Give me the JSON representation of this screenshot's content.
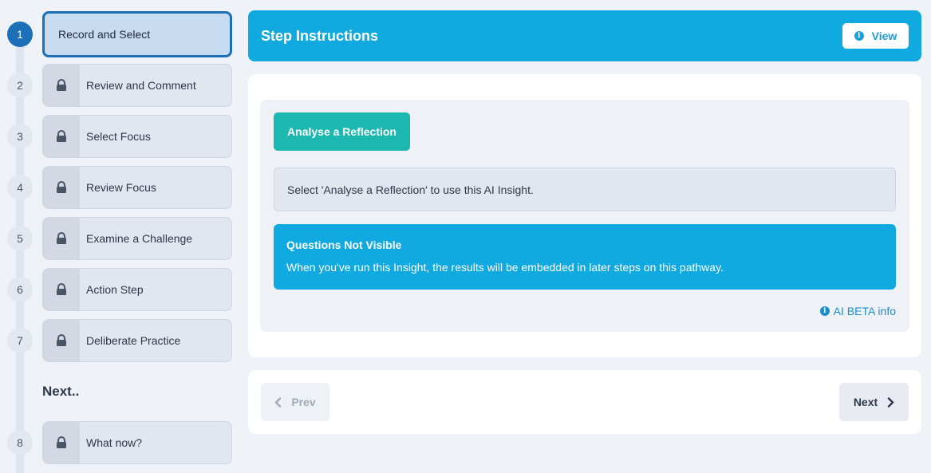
{
  "steps": [
    {
      "number": "1",
      "label": "Record and Select",
      "state": "active"
    },
    {
      "number": "2",
      "label": "Review and Comment",
      "state": "locked"
    },
    {
      "number": "3",
      "label": "Select Focus",
      "state": "locked"
    },
    {
      "number": "4",
      "label": "Review Focus",
      "state": "locked"
    },
    {
      "number": "5",
      "label": "Examine a Challenge",
      "state": "locked"
    },
    {
      "number": "6",
      "label": "Action Step",
      "state": "locked"
    },
    {
      "number": "7",
      "label": "Deliberate Practice",
      "state": "locked"
    },
    {
      "number": "8",
      "label": "What now?",
      "state": "locked"
    }
  ],
  "next_heading": "Next..",
  "header": {
    "title": "Step Instructions",
    "view_label": "View"
  },
  "main": {
    "analyse_button": "Analyse a Reflection",
    "hint": "Select 'Analyse a Reflection' to use this AI Insight.",
    "notice_title": "Questions Not Visible",
    "notice_body": "When you've run this Insight, the results will be embedded in later steps on this pathway.",
    "ai_info_link": "AI BETA info"
  },
  "nav": {
    "prev_label": "Prev",
    "next_label": "Next"
  },
  "colors": {
    "brand": "#10a9e0",
    "active_step": "#1d6fb8",
    "teal_button": "#1cb8b0"
  },
  "icons": {
    "locked_step": "lock-icon",
    "info": "info-circle-icon",
    "prev": "chevron-left-icon",
    "next": "chevron-right-icon"
  }
}
